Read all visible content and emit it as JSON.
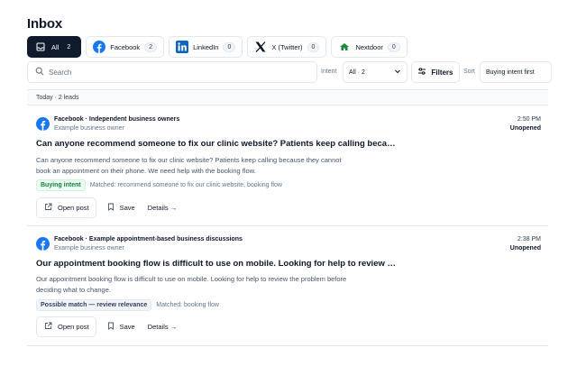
{
  "page": {
    "title": "Inbox"
  },
  "tabs": [
    {
      "label": "All",
      "count": "2",
      "icon": "inbox-icon",
      "active": true
    },
    {
      "label": "Facebook",
      "count": "2",
      "icon": "facebook-icon",
      "active": false
    },
    {
      "label": "LinkedIn",
      "count": "0",
      "icon": "linkedin-icon",
      "active": false
    },
    {
      "label": "X (Twitter)",
      "count": "0",
      "icon": "x-icon",
      "active": false
    },
    {
      "label": "Nextdoor",
      "count": "0",
      "icon": "nextdoor-icon",
      "active": false
    }
  ],
  "toolbar": {
    "search_placeholder": "Search",
    "intent_label": "Intent",
    "intent_value": "All · 2",
    "filters_label": "Filters",
    "sort_label": "Sort",
    "sort_value": "Buying intent first"
  },
  "group": {
    "label": "Today · 2 leads"
  },
  "leads": [
    {
      "source": "Facebook · Independent business owners",
      "author": "Example business owner",
      "time": "2:50 PM",
      "state": "Unopened",
      "headline": "Can anyone recommend someone to fix our clinic website? Patients keep calling because th…",
      "body": "Can anyone recommend someone to fix our clinic website? Patients keep calling because they cannot book an appointment on their phone. We need help with the booking flow.",
      "tag": "Buying intent",
      "matched": "Matched: recommend someone to fix our clinic website, booking flow",
      "open_label": "Open post",
      "save_label": "Save",
      "details_label": "Details →"
    },
    {
      "source": "Facebook · Example appointment-based business discussions",
      "author": "Example business owner",
      "time": "2:38 PM",
      "state": "Unopened",
      "headline": "Our appointment booking flow is difficult to use on mobile. Looking for help to review t…",
      "body": "Our appointment booking flow is difficult to use on mobile. Looking for help to review the problem before deciding what to change.",
      "tag": "Possible match — review relevance",
      "matched": "Matched: booking flow",
      "open_label": "Open post",
      "save_label": "Save",
      "details_label": "Details →"
    }
  ],
  "colors": {
    "facebook": "#1877f2",
    "linkedin": "#0a66c2",
    "nextdoor": "#1b8a3a",
    "active_tab": "#0f1b2d"
  }
}
